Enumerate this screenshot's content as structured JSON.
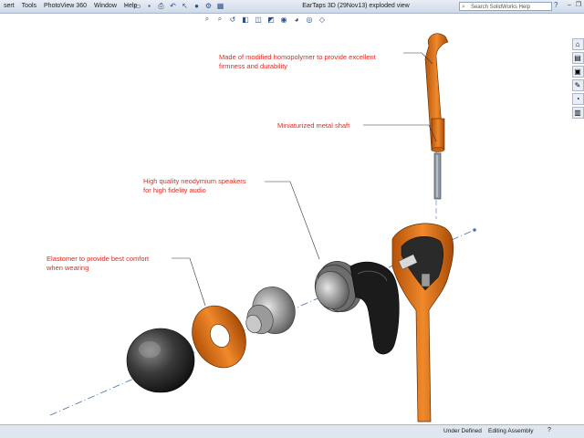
{
  "menu": [
    "sert",
    "Tools",
    "PhotoView 360",
    "Window",
    "Help"
  ],
  "toolbar_icons": [
    "new-icon",
    "open-icon",
    "save-icon",
    "print-icon",
    "undo-icon",
    "select-icon",
    "rebuild-icon",
    "options-icon",
    "view-icon"
  ],
  "document_title": "EarTaps 3D (29Nov13) exploded view",
  "search": {
    "placeholder": "Search SolidWorks Help",
    "help": "?"
  },
  "callouts": {
    "homopolymer": {
      "line1": "Made of modified homopolymer to provide excellent",
      "line2": "firmness and durability"
    },
    "shaft": {
      "line1": "Miniaturized metal shaft"
    },
    "speaker": {
      "line1": "High quality neodymium speakers",
      "line2": "for high fidelity audio"
    },
    "elastomer": {
      "line1": "Elastomer to provide best comfort",
      "line2": "when wearing"
    }
  },
  "status": {
    "definition": "Under Defined",
    "mode": "Editing Assembly",
    "help_icon": "?"
  },
  "colors": {
    "accent_orange": "#e8780c",
    "callout_red": "#e02a1f"
  }
}
